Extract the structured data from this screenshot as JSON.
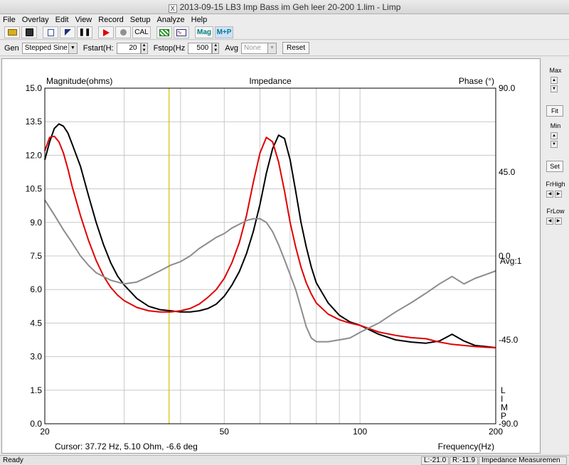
{
  "window": {
    "title": "2013-09-15 LB3 Imp Bass im Geh leer 20-200 1.lim - Limp"
  },
  "menu": [
    "File",
    "Overlay",
    "Edit",
    "View",
    "Record",
    "Setup",
    "Analyze",
    "Help"
  ],
  "toolbar": {
    "cal_label": "CAL",
    "mag_label": "Mag",
    "mp_label": "M+P"
  },
  "controls": {
    "gen_label": "Gen",
    "gen_value": "Stepped Sine",
    "fstart_label": "Fstart(H:",
    "fstart_value": "20",
    "fstop_label": "Fstop(Hz",
    "fstop_value": "500",
    "avg_label": "Avg",
    "avg_value": "None",
    "reset_label": "Reset"
  },
  "side": {
    "max_label": "Max",
    "fit_label": "Fit",
    "min_label": "Min",
    "set_label": "Set",
    "frhigh_label": "FrHigh",
    "frlow_label": "FrLow"
  },
  "status": {
    "ready": "Ready",
    "l": "L:-21.0",
    "r": "R:-11.9",
    "mode": "Impedance Measuremen"
  },
  "chart_data": {
    "type": "line",
    "title": "Impedance",
    "ylabel_left": "Magnitude(ohms)",
    "ylabel_right": "Phase (°)",
    "xlabel": "Frequency(Hz)",
    "xscale": "log",
    "xlim": [
      20,
      200
    ],
    "ylim_left": [
      0,
      15
    ],
    "ylim_right": [
      -90,
      90
    ],
    "x_ticks": [
      "20",
      "50",
      "100",
      "200"
    ],
    "y_ticks_left": [
      "0.0",
      "1.5",
      "3.0",
      "4.5",
      "6.0",
      "7.5",
      "9.0",
      "10.5",
      "12.0",
      "13.5",
      "15.0"
    ],
    "y_ticks_right": [
      "-90.0",
      "-45.0",
      "0.0",
      "45.0",
      "90.0"
    ],
    "right_ticks_positions": [
      9.0,
      10.5,
      12.0,
      13.5,
      15.0
    ],
    "avg_label": "Avg:1",
    "brand_label": "LIMP",
    "cursor_text": "Cursor: 37.72 Hz, 5.10 Ohm, -6.6 deg",
    "cursor_x": 37.72,
    "grid": true,
    "series": [
      {
        "color": "#000000",
        "x": [
          20,
          20.5,
          21,
          21.5,
          22,
          22.5,
          23,
          24,
          25,
          26,
          27,
          28,
          29,
          30,
          32,
          34,
          36,
          38,
          40,
          42,
          44,
          46,
          48,
          50,
          52,
          54,
          56,
          58,
          60,
          62,
          64,
          66,
          68,
          70,
          72,
          74,
          76,
          78,
          80,
          85,
          90,
          95,
          100,
          110,
          120,
          130,
          140,
          150,
          160,
          170,
          180,
          190,
          200
        ],
        "values": [
          11.8,
          12.6,
          13.2,
          13.4,
          13.3,
          13.0,
          12.5,
          11.5,
          10.2,
          9.0,
          8.0,
          7.2,
          6.6,
          6.2,
          5.6,
          5.25,
          5.1,
          5.05,
          5.0,
          5.0,
          5.05,
          5.15,
          5.35,
          5.7,
          6.2,
          6.8,
          7.6,
          8.6,
          9.8,
          11.2,
          12.3,
          12.9,
          12.75,
          11.8,
          10.4,
          9.0,
          7.9,
          7.0,
          6.3,
          5.4,
          4.85,
          4.55,
          4.4,
          4.0,
          3.75,
          3.65,
          3.6,
          3.7,
          4.0,
          3.7,
          3.5,
          3.45,
          3.4
        ]
      },
      {
        "color": "#e00000",
        "x": [
          20,
          20.5,
          21,
          21.5,
          22,
          22.5,
          23,
          24,
          25,
          26,
          27,
          28,
          29,
          30,
          32,
          34,
          36,
          38,
          40,
          42,
          44,
          46,
          48,
          50,
          52,
          54,
          56,
          58,
          60,
          62,
          64,
          66,
          68,
          70,
          72,
          74,
          76,
          78,
          80,
          85,
          90,
          95,
          100,
          110,
          120,
          130,
          140,
          150,
          160,
          170,
          180,
          190,
          200
        ],
        "values": [
          12.2,
          12.8,
          12.85,
          12.6,
          12.1,
          11.4,
          10.6,
          9.3,
          8.2,
          7.3,
          6.6,
          6.1,
          5.75,
          5.5,
          5.2,
          5.05,
          5.0,
          5.0,
          5.05,
          5.15,
          5.35,
          5.65,
          6.0,
          6.5,
          7.2,
          8.1,
          9.3,
          10.8,
          12.1,
          12.8,
          12.6,
          11.7,
          10.4,
          9.0,
          7.9,
          7.0,
          6.3,
          5.8,
          5.4,
          4.9,
          4.65,
          4.5,
          4.4,
          4.1,
          3.95,
          3.85,
          3.8,
          3.65,
          3.55,
          3.5,
          3.45,
          3.42,
          3.4
        ]
      },
      {
        "color": "#8c8c8c",
        "axis": "right",
        "x": [
          20,
          21,
          22,
          23,
          24,
          25,
          26,
          28,
          30,
          32,
          34,
          36,
          38,
          40,
          42,
          44,
          46,
          48,
          50,
          52,
          54,
          56,
          58,
          60,
          62,
          64,
          66,
          68,
          70,
          72,
          74,
          76,
          78,
          80,
          85,
          90,
          95,
          100,
          110,
          120,
          130,
          140,
          150,
          160,
          170,
          180,
          190,
          200
        ],
        "values": [
          30,
          22,
          14,
          7,
          0,
          -5,
          -9,
          -13,
          -15,
          -14,
          -11,
          -8,
          -5,
          -3,
          0,
          4,
          7,
          10,
          12,
          15,
          17,
          19,
          20,
          20,
          18,
          13,
          6,
          -2,
          -10,
          -18,
          -28,
          -38,
          -44,
          -46,
          -46,
          -45,
          -44,
          -41,
          -36,
          -30,
          -25,
          -20,
          -15,
          -11,
          -15,
          -12,
          -10,
          -8
        ]
      }
    ]
  }
}
